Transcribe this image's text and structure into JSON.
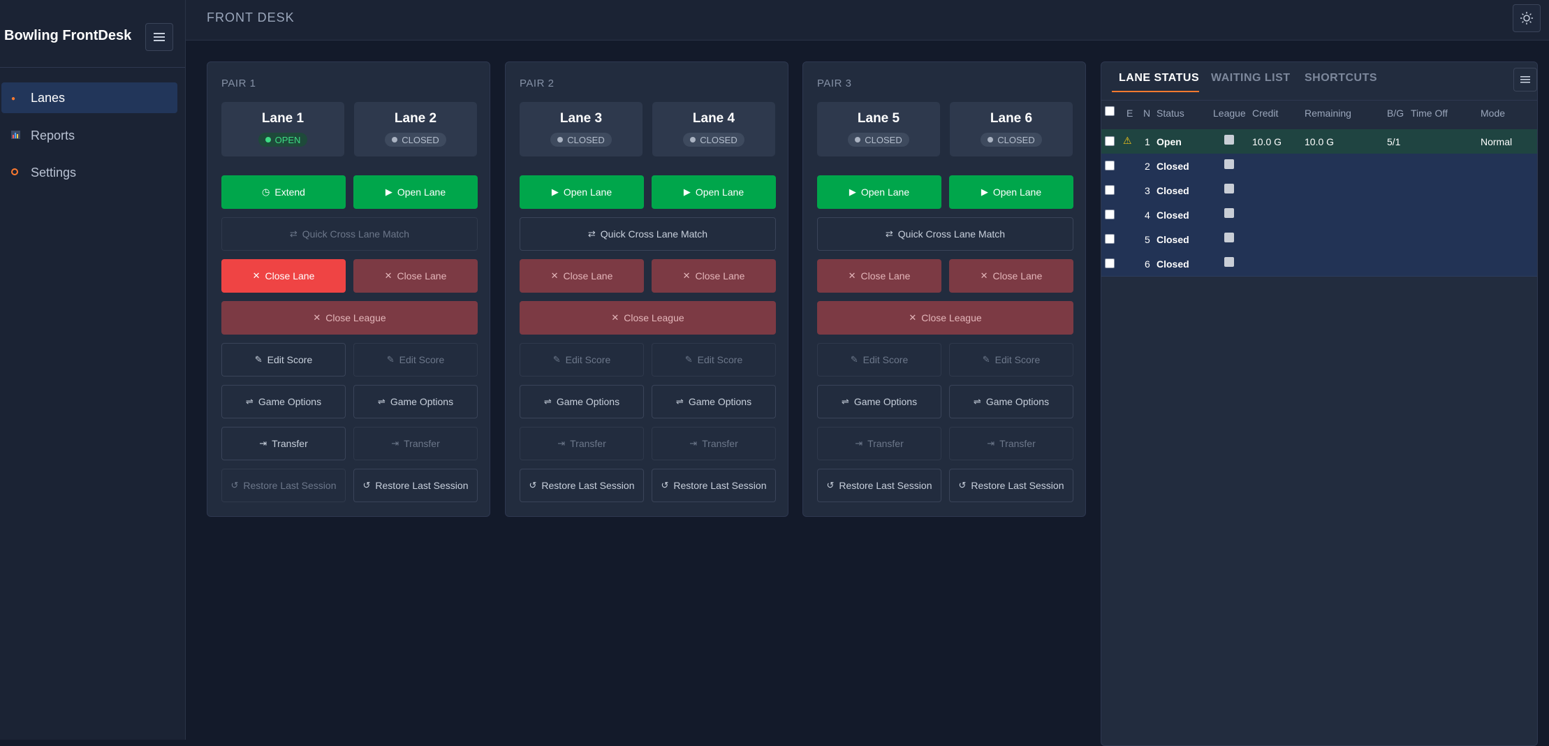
{
  "sidebar": {
    "brand": "Bowling FrontDesk",
    "items": [
      {
        "label": "Lanes",
        "icon": "dot-icon"
      },
      {
        "label": "Reports",
        "icon": "chart-icon"
      },
      {
        "label": "Settings",
        "icon": "gear-icon"
      }
    ]
  },
  "header": {
    "title": "FRONT DESK"
  },
  "pairs": [
    {
      "title": "PAIR 1",
      "lanes": [
        {
          "name": "Lane 1",
          "status": "OPEN"
        },
        {
          "name": "Lane 2",
          "status": "CLOSED"
        }
      ],
      "buttons": {
        "left_primary": "Extend",
        "right_primary": "Open Lane",
        "cross": "Quick Cross Lane Match",
        "close_left": "Close Lane",
        "close_right": "Close Lane",
        "close_league": "Close League",
        "edit_left": "Edit Score",
        "edit_right": "Edit Score",
        "options_left": "Game Options",
        "options_right": "Game Options",
        "transfer_left": "Transfer",
        "transfer_right": "Transfer",
        "restore_left": "Restore Last Session",
        "restore_right": "Restore Last Session"
      }
    },
    {
      "title": "PAIR 2",
      "lanes": [
        {
          "name": "Lane 3",
          "status": "CLOSED"
        },
        {
          "name": "Lane 4",
          "status": "CLOSED"
        }
      ],
      "buttons": {
        "left_primary": "Open Lane",
        "right_primary": "Open Lane",
        "cross": "Quick Cross Lane Match",
        "close_left": "Close Lane",
        "close_right": "Close Lane",
        "close_league": "Close League",
        "edit_left": "Edit Score",
        "edit_right": "Edit Score",
        "options_left": "Game Options",
        "options_right": "Game Options",
        "transfer_left": "Transfer",
        "transfer_right": "Transfer",
        "restore_left": "Restore Last Session",
        "restore_right": "Restore Last Session"
      }
    },
    {
      "title": "PAIR 3",
      "lanes": [
        {
          "name": "Lane 5",
          "status": "CLOSED"
        },
        {
          "name": "Lane 6",
          "status": "CLOSED"
        }
      ],
      "buttons": {
        "left_primary": "Open Lane",
        "right_primary": "Open Lane",
        "cross": "Quick Cross Lane Match",
        "close_left": "Close Lane",
        "close_right": "Close Lane",
        "close_league": "Close League",
        "edit_left": "Edit Score",
        "edit_right": "Edit Score",
        "options_left": "Game Options",
        "options_right": "Game Options",
        "transfer_left": "Transfer",
        "transfer_right": "Transfer",
        "restore_left": "Restore Last Session",
        "restore_right": "Restore Last Session"
      }
    }
  ],
  "panel": {
    "tabs": [
      "LANE STATUS",
      "WAITING LIST",
      "SHORTCUTS"
    ],
    "columns": [
      "E",
      "N",
      "Status",
      "League",
      "Credit",
      "Remaining",
      "B/G",
      "Time Off",
      "Mode"
    ],
    "rows": [
      {
        "n": "1",
        "status": "Open",
        "credit": "10.0 G",
        "remaining": "10.0 G",
        "bg": "5/1",
        "time_off": "",
        "mode": "Normal"
      },
      {
        "n": "2",
        "status": "Closed",
        "credit": "",
        "remaining": "",
        "bg": "",
        "time_off": "",
        "mode": ""
      },
      {
        "n": "3",
        "status": "Closed",
        "credit": "",
        "remaining": "",
        "bg": "",
        "time_off": "",
        "mode": ""
      },
      {
        "n": "4",
        "status": "Closed",
        "credit": "",
        "remaining": "",
        "bg": "",
        "time_off": "",
        "mode": ""
      },
      {
        "n": "5",
        "status": "Closed",
        "credit": "",
        "remaining": "",
        "bg": "",
        "time_off": "",
        "mode": ""
      },
      {
        "n": "6",
        "status": "Closed",
        "credit": "",
        "remaining": "",
        "bg": "",
        "time_off": "",
        "mode": ""
      }
    ]
  },
  "colors": {
    "accent": "#ff7a2f",
    "green": "#00a64b",
    "red": "#ef4444",
    "background": "#131a2a"
  }
}
